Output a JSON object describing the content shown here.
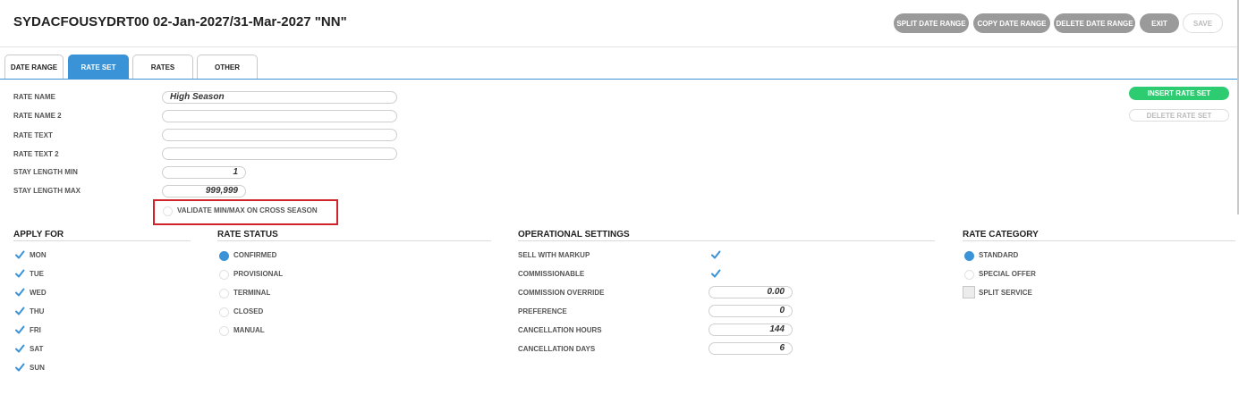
{
  "header": {
    "title": "SYDACFOUSYDRT00 02-Jan-2027/31-Mar-2027 \"NN\"",
    "buttons": {
      "split": "SPLIT DATE RANGE",
      "copy": "COPY DATE RANGE",
      "delete": "DELETE DATE RANGE",
      "exit": "EXIT",
      "save": "SAVE"
    }
  },
  "tabs": [
    "DATE RANGE",
    "RATE SET",
    "RATES",
    "OTHER"
  ],
  "active_tab": "RATE SET",
  "form": {
    "rate_name_label": "RATE NAME",
    "rate_name_value": "High Season",
    "rate_name2_label": "RATE NAME 2",
    "rate_text_label": "RATE TEXT",
    "rate_text2_label": "RATE TEXT 2",
    "stay_min_label": "STAY LENGTH MIN",
    "stay_min_value": "1",
    "stay_max_label": "STAY LENGTH MAX",
    "stay_max_value": "999,999",
    "validate_label": "VALIDATE MIN/MAX ON CROSS SEASON",
    "validate_checked": false
  },
  "side_buttons": {
    "insert": "INSERT RATE SET",
    "delete": "DELETE RATE SET"
  },
  "apply_for": {
    "title": "APPLY FOR",
    "days": [
      {
        "label": "MON",
        "checked": true
      },
      {
        "label": "TUE",
        "checked": true
      },
      {
        "label": "WED",
        "checked": true
      },
      {
        "label": "THU",
        "checked": true
      },
      {
        "label": "FRI",
        "checked": true
      },
      {
        "label": "SAT",
        "checked": true
      },
      {
        "label": "SUN",
        "checked": true
      }
    ]
  },
  "rate_status": {
    "title": "RATE STATUS",
    "options": [
      {
        "label": "CONFIRMED",
        "selected": true
      },
      {
        "label": "PROVISIONAL",
        "selected": false
      },
      {
        "label": "TERMINAL",
        "selected": false
      },
      {
        "label": "CLOSED",
        "selected": false
      },
      {
        "label": "MANUAL",
        "selected": false
      }
    ]
  },
  "operational": {
    "title": "OPERATIONAL SETTINGS",
    "sell_with_markup_label": "SELL WITH MARKUP",
    "sell_with_markup": true,
    "commissionable_label": "COMMISSIONABLE",
    "commissionable": true,
    "commission_override_label": "COMMISSION OVERRIDE",
    "commission_override": "0.00",
    "preference_label": "PREFERENCE",
    "preference": "0",
    "cancellation_hours_label": "CANCELLATION HOURS",
    "cancellation_hours": "144",
    "cancellation_days_label": "CANCELLATION DAYS",
    "cancellation_days": "6"
  },
  "rate_category": {
    "title": "RATE CATEGORY",
    "standard": "STANDARD",
    "special_offer": "SPECIAL OFFER",
    "split_service": "SPLIT SERVICE",
    "selected": "STANDARD"
  },
  "colors": {
    "accent": "#3a93d6",
    "insert_button": "#2ecc71",
    "highlight_box": "#d3232a"
  }
}
